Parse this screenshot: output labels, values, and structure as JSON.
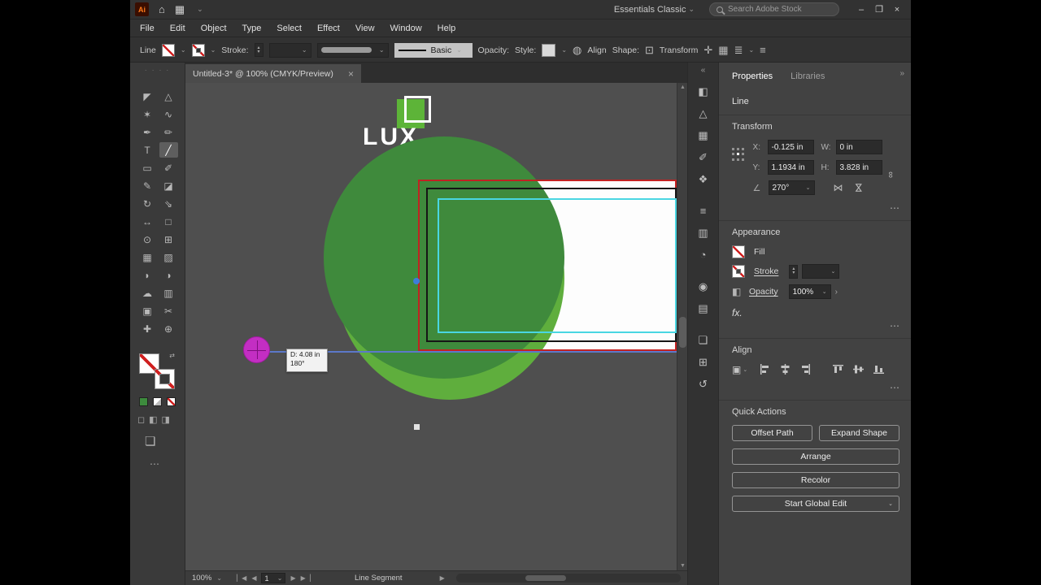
{
  "titlebar": {
    "app_icon_text": "Ai",
    "workspace": "Essentials Classic",
    "search_placeholder": "Search Adobe Stock"
  },
  "icons": {
    "chevron_down": "⌄",
    "chevron_right": "›",
    "more": "⋯",
    "home": "⌂",
    "grid": "▦",
    "rows_view": "≣",
    "menu_list": "≡",
    "minimize": "–",
    "restore": "❐",
    "close": "×",
    "stepper_up": "▴",
    "stepper_down": "▾",
    "angle": "∠",
    "link": "∞",
    "flip": "⋈",
    "swap": "⇄",
    "play_right": "▶",
    "play_left": "◀",
    "bar_left": "▏",
    "bar_right": "▕",
    "scroll_up": "▲",
    "scroll_down": "▼",
    "collapse_left": "«",
    "collapse_right": "»",
    "drag_dots": "· · · ·",
    "recolor_wheel": "◍",
    "shape_widget": "⊡",
    "transform_widget": "✛",
    "mode_normal": "◻",
    "mode_behind": "◧",
    "mode_inside": "◨",
    "panel_square": "❏",
    "align_box": "▣"
  },
  "menus": [
    "File",
    "Edit",
    "Object",
    "Type",
    "Select",
    "Effect",
    "View",
    "Window",
    "Help"
  ],
  "control_bar": {
    "tool_name": "Line",
    "stroke_label": "Stroke:",
    "stroke_style": "Basic",
    "opacity_label": "Opacity:",
    "style_label": "Style:",
    "align_label": "Align",
    "shape_label": "Shape:",
    "transform_label": "Transform"
  },
  "document_tab": {
    "title": "Untitled-3* @ 100% (CMYK/Preview)"
  },
  "tools": [
    {
      "name": "selection",
      "glyph": "◤"
    },
    {
      "name": "direct-selection",
      "glyph": "△"
    },
    {
      "name": "magic-wand",
      "glyph": "✶"
    },
    {
      "name": "lasso",
      "glyph": "∿"
    },
    {
      "name": "pen",
      "glyph": "✒"
    },
    {
      "name": "curvature",
      "glyph": "✏"
    },
    {
      "name": "type",
      "glyph": "T"
    },
    {
      "name": "line-segment",
      "glyph": "╱"
    },
    {
      "name": "rectangle",
      "glyph": "▭"
    },
    {
      "name": "paintbrush",
      "glyph": "✐"
    },
    {
      "name": "pencil",
      "glyph": "✎"
    },
    {
      "name": "eraser",
      "glyph": "◪"
    },
    {
      "name": "rotate",
      "glyph": "↻"
    },
    {
      "name": "scale",
      "glyph": "⇘"
    },
    {
      "name": "width",
      "glyph": "↔"
    },
    {
      "name": "free-transform",
      "glyph": "□"
    },
    {
      "name": "shape-builder",
      "glyph": "⊙"
    },
    {
      "name": "perspective-grid",
      "glyph": "⊞"
    },
    {
      "name": "mesh",
      "glyph": "▦"
    },
    {
      "name": "gradient",
      "glyph": "▨"
    },
    {
      "name": "eyedropper",
      "glyph": "◗"
    },
    {
      "name": "blend",
      "glyph": "◑"
    },
    {
      "name": "symbol-sprayer",
      "glyph": "☁"
    },
    {
      "name": "column-graph",
      "glyph": "▥"
    },
    {
      "name": "artboard",
      "glyph": "▣"
    },
    {
      "name": "slice",
      "glyph": "✂"
    },
    {
      "name": "hand",
      "glyph": "✚"
    },
    {
      "name": "zoom",
      "glyph": "⊕"
    }
  ],
  "dock_icons": [
    {
      "name": "color",
      "glyph": "◧"
    },
    {
      "name": "color-guide",
      "glyph": "△"
    },
    {
      "name": "swatches",
      "glyph": "▦"
    },
    {
      "name": "brushes",
      "glyph": "✐"
    },
    {
      "name": "symbols",
      "glyph": "❖"
    },
    {
      "name": "stroke",
      "glyph": "≡"
    },
    {
      "name": "gradient",
      "glyph": "▥"
    },
    {
      "name": "transparency",
      "glyph": "◔"
    },
    {
      "name": "appearance",
      "glyph": "◉"
    },
    {
      "name": "graphic-styles",
      "glyph": "▤"
    },
    {
      "name": "layers",
      "glyph": "❏"
    },
    {
      "name": "artboards",
      "glyph": "⊞"
    },
    {
      "name": "history",
      "glyph": "↺"
    }
  ],
  "canvas": {
    "logo_text": "LUX",
    "tooltip_line1": "D: 4.08 in",
    "tooltip_line2": "180°"
  },
  "properties": {
    "tabs": [
      "Properties",
      "Libraries"
    ],
    "selection_type": "Line",
    "transform": {
      "title": "Transform",
      "x_label": "X:",
      "x_value": "-0.125 in",
      "y_label": "Y:",
      "y_value": "1.1934 in",
      "w_label": "W:",
      "w_value": "0 in",
      "h_label": "H:",
      "h_value": "3.828 in",
      "angle_value": "270°"
    },
    "appearance": {
      "title": "Appearance",
      "fill_label": "Fill",
      "stroke_label": "Stroke",
      "opacity_label": "Opacity",
      "opacity_value": "100%",
      "fx_label": "fx."
    },
    "align": {
      "title": "Align"
    },
    "quick_actions": {
      "title": "Quick Actions",
      "offset_path": "Offset Path",
      "expand_shape": "Expand Shape",
      "arrange": "Arrange",
      "recolor": "Recolor",
      "start_global_edit": "Start Global Edit"
    }
  },
  "status_bar": {
    "zoom": "100%",
    "artboard_value": "1",
    "status": "Line Segment"
  },
  "colors": {
    "accent_magenta": "#c32ec3",
    "green_dark": "#3f8a3c",
    "green_light": "#5fae3d",
    "selection_red": "#c22222",
    "guide_cyan": "#49d6e2",
    "measure_blue": "#5c78c9"
  }
}
